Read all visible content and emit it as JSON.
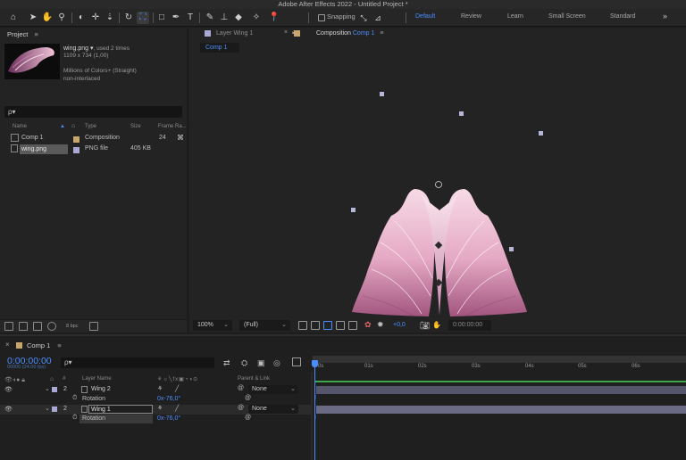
{
  "app": {
    "title": "Adobe After Effects 2022 - Untitled Project *"
  },
  "toolbar": {
    "snapping_label": "Snapping",
    "workspaces": [
      {
        "label": "Default",
        "active": true
      },
      {
        "label": "Review",
        "active": false
      },
      {
        "label": "Learn",
        "active": false
      },
      {
        "label": "Small Screen",
        "active": false
      },
      {
        "label": "Standard",
        "active": false
      }
    ],
    "more_label": "»"
  },
  "project": {
    "tab_label": "Project",
    "menu_glyph": "≡",
    "preview": {
      "name": "wing.png ▾",
      "used": ", used 2 times",
      "dims": "1109 x 734 (1,00)",
      "colors": "Millions of Colors+ (Straight)",
      "interlace": "non-interlaced"
    },
    "search_icon": "ρ▾",
    "columns": [
      "Name",
      "Type",
      "Size",
      "Frame Ra..."
    ],
    "items": [
      {
        "name": "Comp 1",
        "type": "Composition",
        "size": "",
        "frame_rate": "24",
        "label_color": "#c9a66b"
      },
      {
        "name": "wing.png",
        "type": "PNG file",
        "size": "405 KB",
        "frame_rate": "",
        "label_color": "#a9a9d4"
      }
    ],
    "bpc_label": "8 bpc"
  },
  "composition": {
    "layer_tab_label": "Layer Wing 1",
    "comp_tab_prefix": "Composition",
    "comp_tab_name": "Comp 1",
    "tab_menu_glyph": "≡",
    "close_glyph": "×",
    "crumb": "Comp 1",
    "zoom": "100%",
    "resolution": "(Full)",
    "exposure": "+0,0",
    "timecode": "0:00:00:00"
  },
  "timeline": {
    "close_glyph": "×",
    "tab_label": "Comp 1",
    "menu_glyph": "≡",
    "timecode": "0:00:00:00",
    "timecode_sub": "00000 (24.00 fps)",
    "search_icon": "ρ▾",
    "headers": {
      "num": "#",
      "layer_name": "Layer Name",
      "parent": "Parent & Link"
    },
    "ruler": [
      "0s",
      "01s",
      "02s",
      "03s",
      "04s",
      "05s",
      "06s"
    ],
    "layers": [
      {
        "num": "2",
        "name": "Wing 2",
        "parent": "None",
        "prop_label": "Rotation",
        "prop_value": "0x-76,0°",
        "label_color": "#a9a9d4",
        "selected": false
      },
      {
        "num": "2",
        "name": "Wing 1",
        "parent": "None",
        "prop_label": "Rotation",
        "prop_value": "0x-76,0°",
        "label_color": "#a9a9d4",
        "selected": true
      }
    ]
  }
}
